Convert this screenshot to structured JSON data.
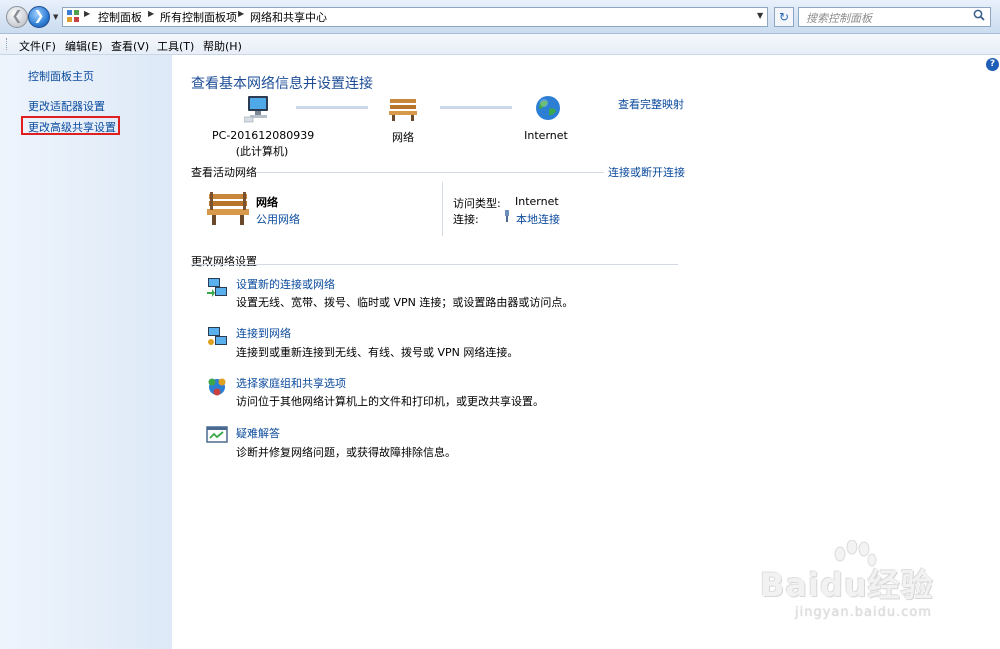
{
  "address": {
    "crumbs": [
      "控制面板",
      "所有控制面板项",
      "网络和共享中心"
    ],
    "search_placeholder": "搜索控制面板"
  },
  "menu": [
    "文件(F)",
    "编辑(E)",
    "查看(V)",
    "工具(T)",
    "帮助(H)"
  ],
  "sidebar": {
    "items": [
      {
        "label": "控制面板主页"
      },
      {
        "label": "更改适配器设置"
      },
      {
        "label": "更改高级共享设置",
        "highlighted": true
      }
    ]
  },
  "main": {
    "title": "查看基本网络信息并设置连接",
    "full_map": "查看完整映射",
    "map": {
      "computer_name": "PC-201612080939",
      "computer_sub": "(此计算机)",
      "network": "网络",
      "internet": "Internet"
    },
    "active": {
      "header": "查看活动网络",
      "connect_link": "连接或断开连接",
      "network_name": "网络",
      "network_type": "公用网络",
      "access_label": "访问类型:",
      "access_value": "Internet",
      "conn_label": "连接:",
      "conn_value": "本地连接"
    },
    "change": {
      "header": "更改网络设置",
      "tasks": [
        {
          "link": "设置新的连接或网络",
          "desc": "设置无线、宽带、拨号、临时或 VPN 连接；或设置路由器或访问点。",
          "icon": "new-connection-icon"
        },
        {
          "link": "连接到网络",
          "desc": "连接到或重新连接到无线、有线、拨号或 VPN 网络连接。",
          "icon": "connect-network-icon"
        },
        {
          "link": "选择家庭组和共享选项",
          "desc": "访问位于其他网络计算机上的文件和打印机，或更改共享设置。",
          "icon": "homegroup-icon"
        },
        {
          "link": "疑难解答",
          "desc": "诊断并修复网络问题，或获得故障排除信息。",
          "icon": "troubleshoot-icon"
        }
      ]
    }
  },
  "watermark": {
    "logo": "Baidu经验",
    "url": "jingyan.baidu.com"
  },
  "colors": {
    "link": "#0a4a9c",
    "title": "#1e4d96",
    "highlight_border": "#e02020"
  }
}
